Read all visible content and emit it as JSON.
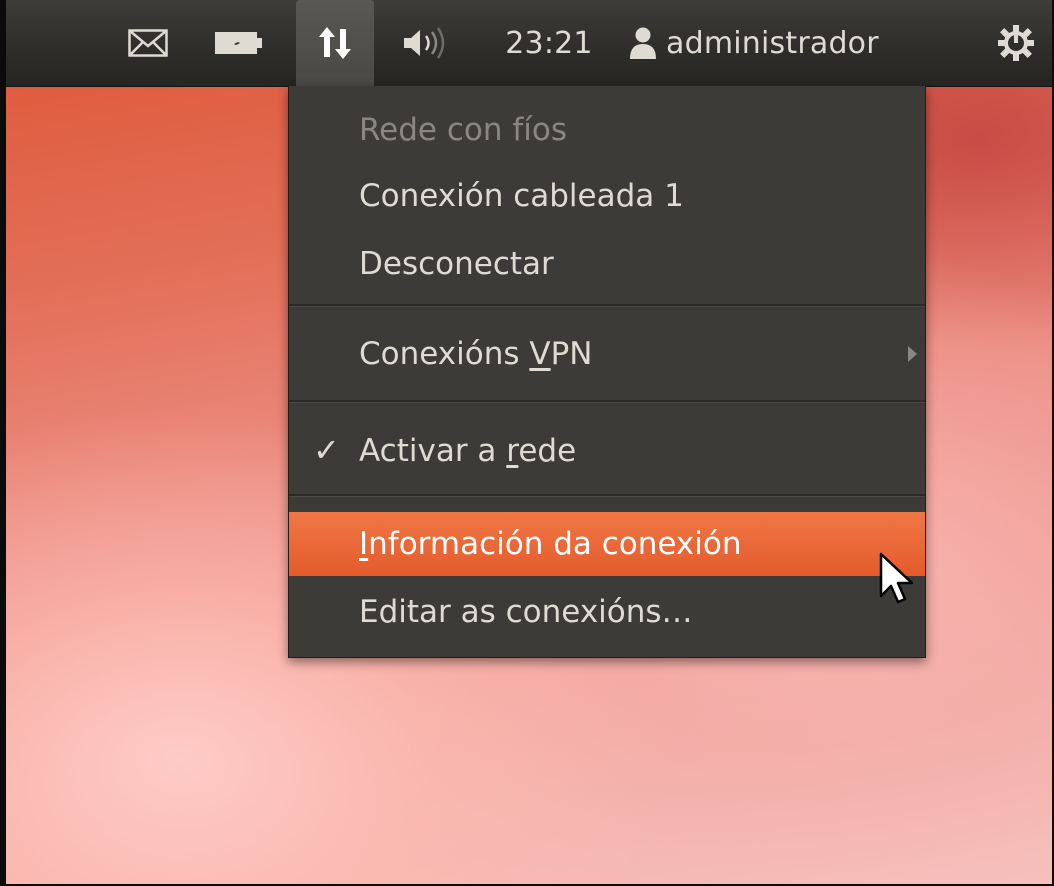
{
  "panel": {
    "indicators": [
      {
        "name": "mail",
        "icon": "envelope-icon"
      },
      {
        "name": "battery",
        "icon": "battery-charging-icon"
      },
      {
        "name": "network",
        "icon": "network-updown-icon",
        "active": true
      },
      {
        "name": "sound",
        "icon": "speaker-icon"
      }
    ],
    "clock": "23:21",
    "user_icon": "user-icon",
    "user_name": "administrador",
    "session_icon": "power-gear-icon"
  },
  "menu": {
    "section_header": "Rede con fíos",
    "items": [
      {
        "label": "Conexión cableada 1"
      },
      {
        "label": "Desconectar"
      }
    ],
    "vpn": {
      "before": "Conexións ",
      "mnemonic": "V",
      "after": "PN",
      "has_submenu": true
    },
    "enable_network": {
      "before": "Activar a ",
      "mnemonic": "r",
      "after": "ede",
      "checked": true
    },
    "connection_info": {
      "mnemonic": "I",
      "after": "nformación da conexión",
      "highlighted": true
    },
    "edit_connections": {
      "label": "Editar as conexións…"
    }
  },
  "colors": {
    "panel_bg": "#2f2e2a",
    "menu_bg": "#3c3b37",
    "highlight": "#e9612f",
    "text": "#dfdbd2",
    "text_disabled": "#8b8780"
  }
}
